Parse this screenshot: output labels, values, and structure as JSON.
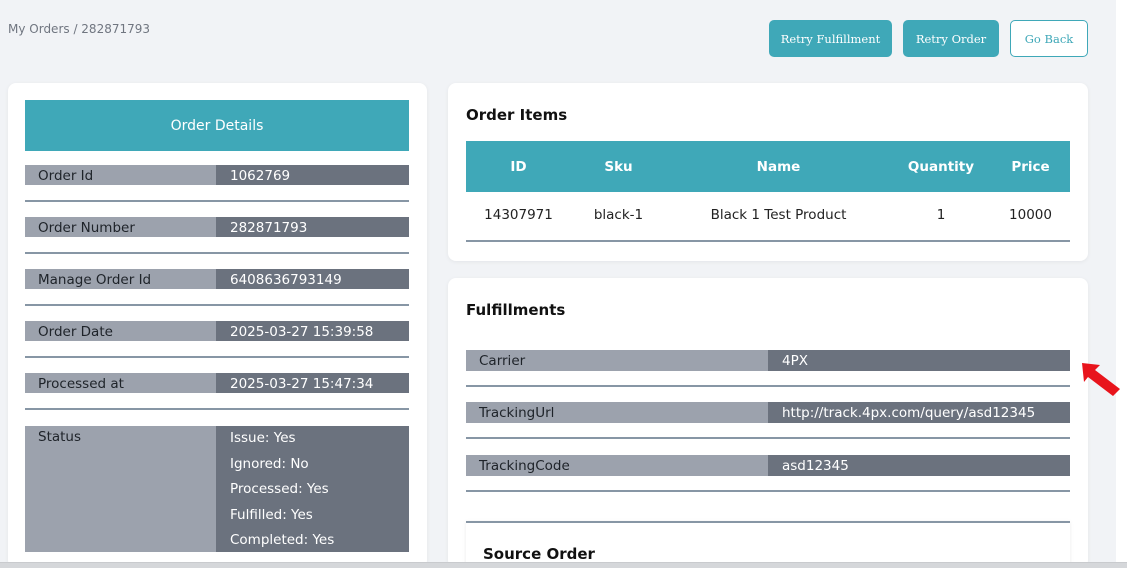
{
  "breadcrumb": "My Orders / 282871793",
  "actions": {
    "retry_fulfillment": "Retry Fulfillment",
    "retry_order": "Retry Order",
    "go_back": "Go Back"
  },
  "order_details": {
    "title": "Order Details",
    "rows": [
      {
        "key": "Order Id",
        "value": "1062769"
      },
      {
        "key": "Order Number",
        "value": "282871793"
      },
      {
        "key": "Manage Order Id",
        "value": "6408636793149"
      },
      {
        "key": "Order Date",
        "value": "2025-03-27 15:39:58"
      },
      {
        "key": "Processed at",
        "value": "2025-03-27 15:47:34"
      }
    ],
    "status": {
      "key": "Status",
      "lines": [
        "Issue: Yes",
        "Ignored: No",
        "Processed: Yes",
        "Fulfilled: Yes",
        "Completed: Yes"
      ]
    }
  },
  "order_items": {
    "title": "Order Items",
    "columns": [
      "ID",
      "Sku",
      "Name",
      "Quantity",
      "Price"
    ],
    "rows": [
      [
        "14307971",
        "black-1",
        "Black 1 Test Product",
        "1",
        "10000"
      ]
    ]
  },
  "fulfillments": {
    "title": "Fulfillments",
    "rows": [
      {
        "key": "Carrier",
        "value": "4PX"
      },
      {
        "key": "TrackingUrl",
        "value": "http://track.4px.com/query/asd12345"
      },
      {
        "key": "TrackingCode",
        "value": "asd12345"
      }
    ]
  },
  "source_order": {
    "title": "Source Order"
  },
  "colors": {
    "accent": "#3fa8b8",
    "key_bg": "#9ca2ad",
    "value_bg": "#6b727e",
    "pointer_arrow": "#e8141c"
  },
  "icons": {
    "pointer": "red-arrow-icon"
  }
}
